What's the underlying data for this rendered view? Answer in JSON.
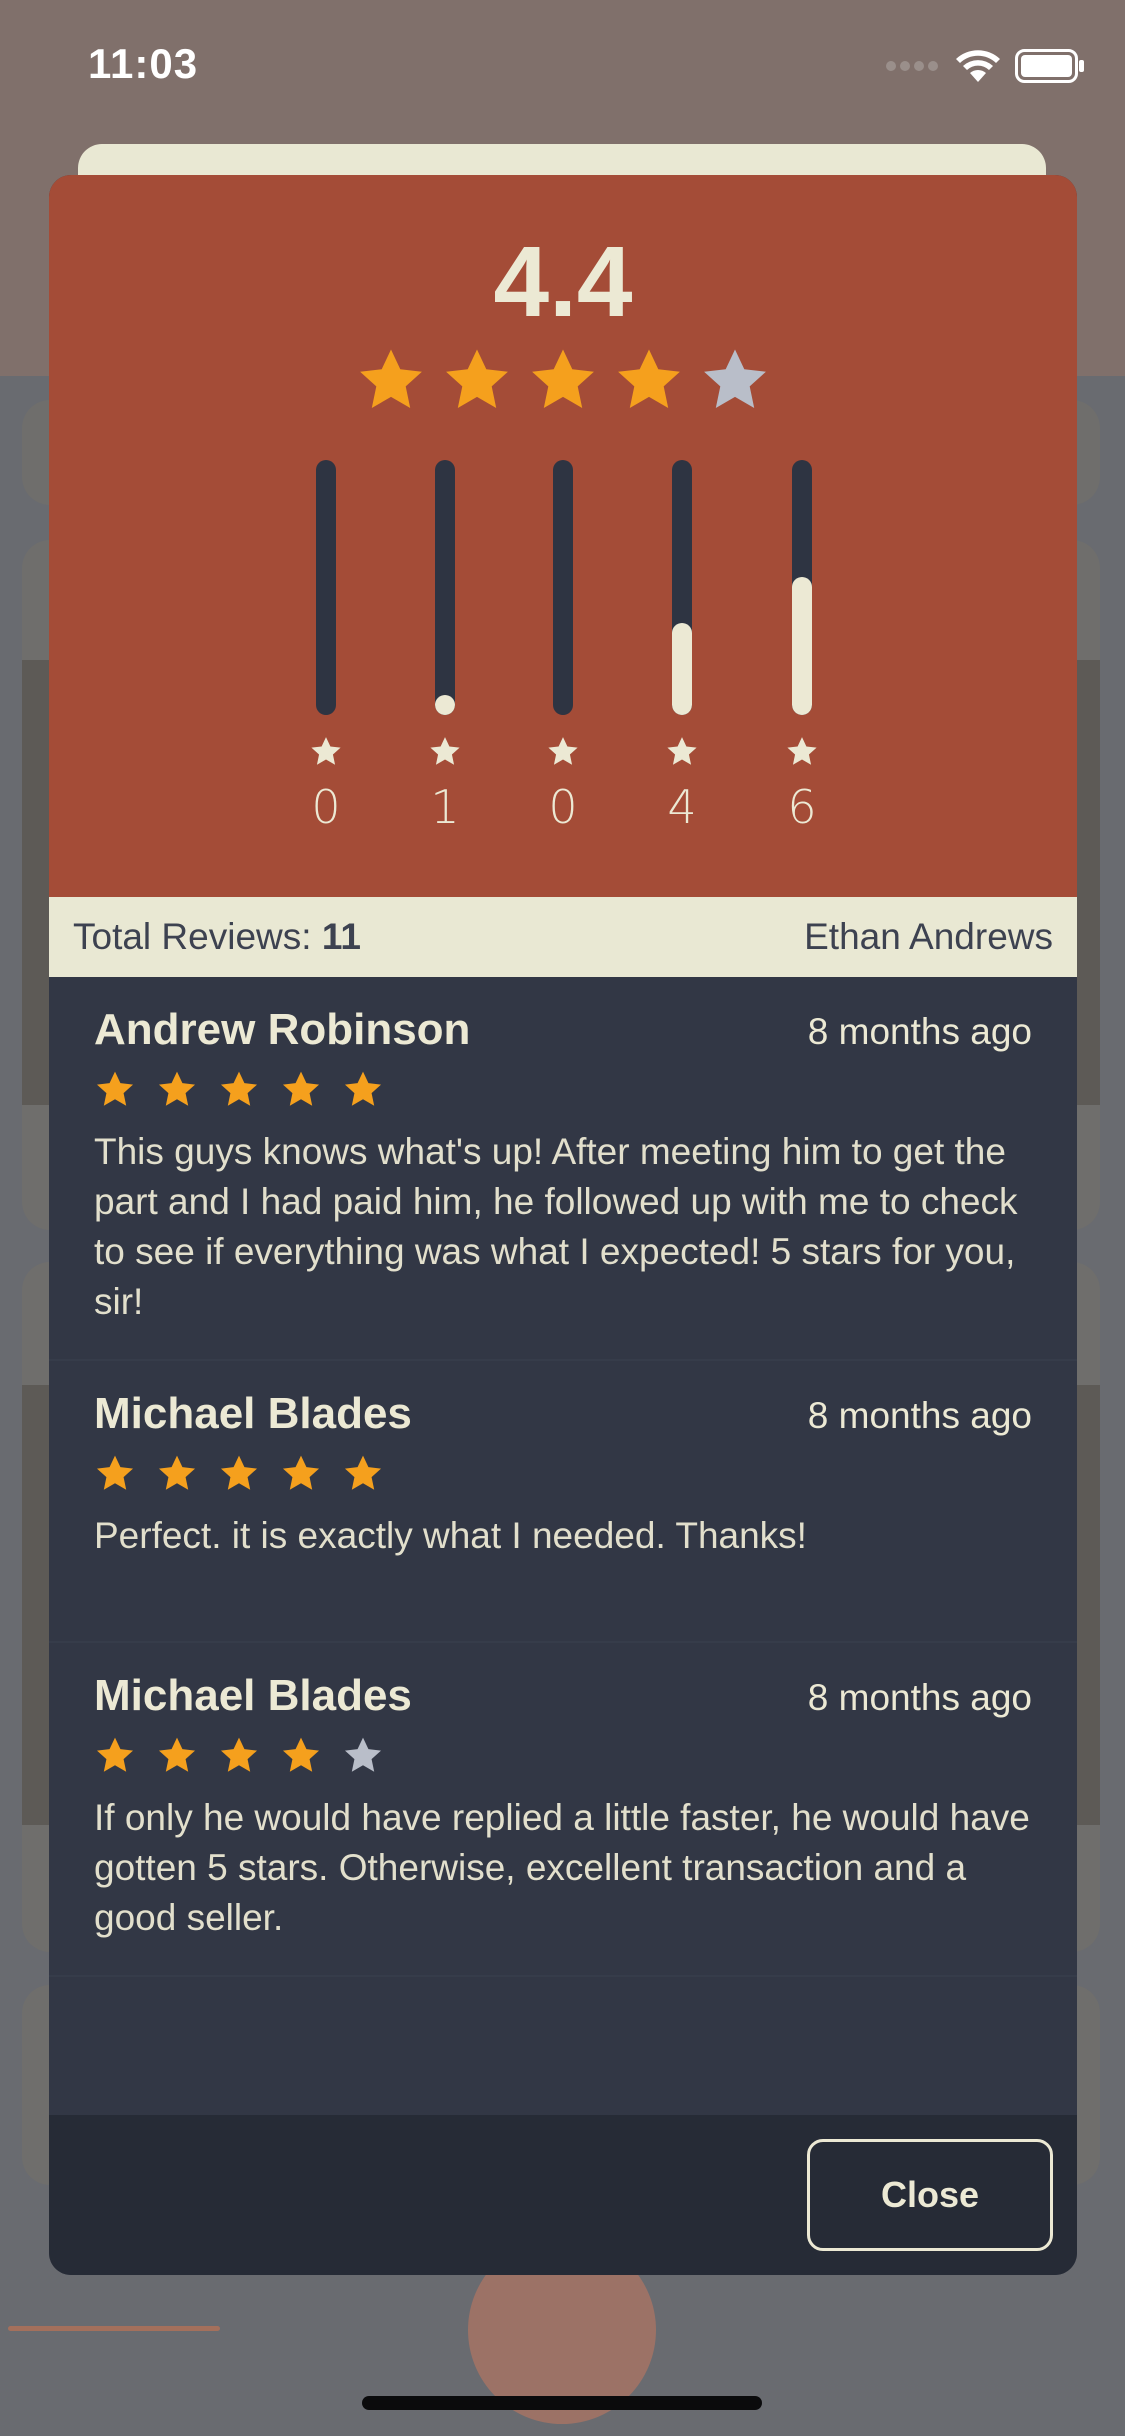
{
  "status_bar": {
    "time": "11:03"
  },
  "summary": {
    "average": "4.4",
    "average_value": 4.4,
    "star_color_filled": "#f5a01d",
    "star_color_empty": "#b9bec9",
    "distribution": [
      {
        "count": "0",
        "fraction": 0.0
      },
      {
        "count": "1",
        "fraction": 0.06
      },
      {
        "count": "0",
        "fraction": 0.0
      },
      {
        "count": "4",
        "fraction": 0.36
      },
      {
        "count": "6",
        "fraction": 0.54
      }
    ]
  },
  "info_bar": {
    "total_label": "Total Reviews:",
    "total_value": "11",
    "seller_name": "Ethan Andrews"
  },
  "reviews": [
    {
      "name": "Andrew Robinson",
      "time": "8 months ago",
      "rating": 5,
      "text": "This guys knows what's up! After meeting him to get the part and I had paid him, he followed up with me to check to see if everything was what I expected! 5 stars for you, sir!"
    },
    {
      "name": "Michael Blades",
      "time": "8 months ago",
      "rating": 5,
      "text": "Perfect. it is exactly what I needed. Thanks!"
    },
    {
      "name": "Michael Blades",
      "time": "8 months ago",
      "rating": 4,
      "text": "If only he would have replied a little faster, he would have gotten 5 stars. Otherwise, excellent transaction and a good seller."
    }
  ],
  "footer": {
    "close_label": "Close"
  }
}
